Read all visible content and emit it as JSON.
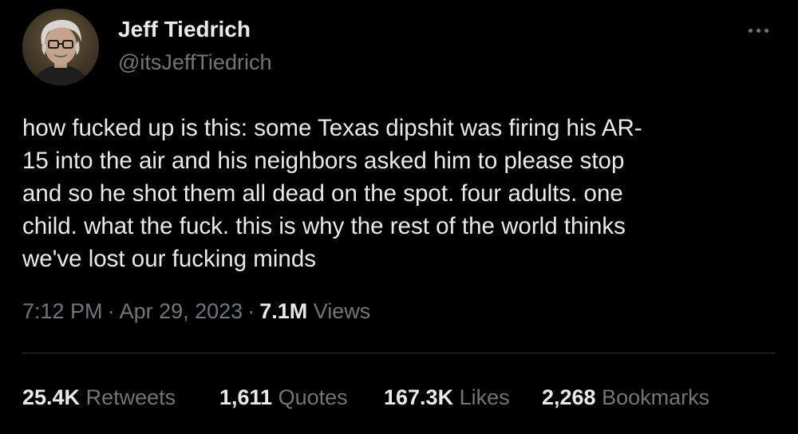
{
  "user": {
    "display_name": "Jeff Tiedrich",
    "handle": "@itsJeffTiedrich"
  },
  "tweet": {
    "text": "how fucked up is this: some Texas dipshit was firing his AR-\n15 into the air and his neighbors asked him to please stop\nand so he shot them all dead on the spot. four adults. one\nchild. what the fuck. this is why the rest of the world thinks\nwe've lost our fucking minds"
  },
  "meta": {
    "time": "7:12 PM",
    "separator": "·",
    "date": "Apr 29, 2023",
    "views_count": "7.1M",
    "views_label": "Views"
  },
  "stats": [
    {
      "count": "25.4K",
      "label": "Retweets"
    },
    {
      "count": "1,611",
      "label": "Quotes"
    },
    {
      "count": "167.3K",
      "label": "Likes"
    },
    {
      "count": "2,268",
      "label": "Bookmarks"
    }
  ],
  "icons": {
    "more": "more-horizontal-icon"
  },
  "colors": {
    "background": "#000000",
    "primary_text": "#e7e9ea",
    "secondary_text": "#71767b",
    "divider": "#2f3336"
  }
}
